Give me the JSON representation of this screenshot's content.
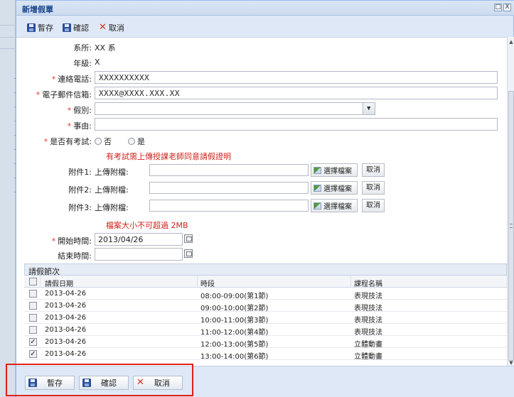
{
  "window": {
    "title": "新增假單",
    "btn_restore": "□",
    "btn_close": "X"
  },
  "toolbar": {
    "save": "暫存",
    "confirm": "確認",
    "cancel": "取消"
  },
  "form": {
    "department_label": "系所:",
    "department_value": "XX 系",
    "grade_label": "年級:",
    "grade_value": "X",
    "phone_label": "連絡電話:",
    "phone_value": "XXXXXXXXXX",
    "email_label": "電子郵件信箱:",
    "email_value": "XXXX@XXXX.XXX.XX",
    "leave_type_label": "假別:",
    "leave_type_value": "",
    "reason_label": "事由:",
    "reason_value": "",
    "exam_label": "是否有考試:",
    "exam_no": "否",
    "exam_yes": "是",
    "exam_note": "有考試需上傳授課老師同意請假證明",
    "attachments": [
      {
        "label": "附件1:",
        "upload_label": "上傳附檔:"
      },
      {
        "label": "附件2:",
        "upload_label": "上傳附檔:"
      },
      {
        "label": "附件3:",
        "upload_label": "上傳附檔:"
      }
    ],
    "select_file": "選擇檔案",
    "cancel": "取消",
    "size_note": "檔案大小不可超過 2MB",
    "start_label": "開始時間:",
    "start_value": "2013/04/26",
    "end_label": "結束時間:",
    "end_value": ""
  },
  "grid": {
    "title": "請假節次",
    "headers": {
      "date": "請假日期",
      "period": "時段",
      "course": "課程名稱"
    },
    "rows": [
      {
        "checked": "",
        "date": "2013-04-26",
        "period": "08:00-09:00(第1節)",
        "course": "表現技法"
      },
      {
        "checked": "",
        "date": "2013-04-26",
        "period": "09:00-10:00(第2節)",
        "course": "表現技法"
      },
      {
        "checked": "",
        "date": "2013-04-26",
        "period": "10:00-11:00(第3節)",
        "course": "表現技法"
      },
      {
        "checked": "",
        "date": "2013-04-26",
        "period": "11:00-12:00(第4節)",
        "course": "表現技法"
      },
      {
        "checked": "✓",
        "date": "2013-04-26",
        "period": "12:00-13:00(第5節)",
        "course": "立體動畫"
      },
      {
        "checked": "✓",
        "date": "2013-04-26",
        "period": "13:00-14:00(第6節)",
        "course": "立體動畫"
      }
    ]
  },
  "footer": {
    "save": "暫存",
    "confirm": "確認",
    "cancel": "取消"
  },
  "colors": {
    "required": "#e23a2a",
    "note": "#d0221b",
    "highlight": "#e0201a",
    "window_bg": "#dfe8f6"
  }
}
